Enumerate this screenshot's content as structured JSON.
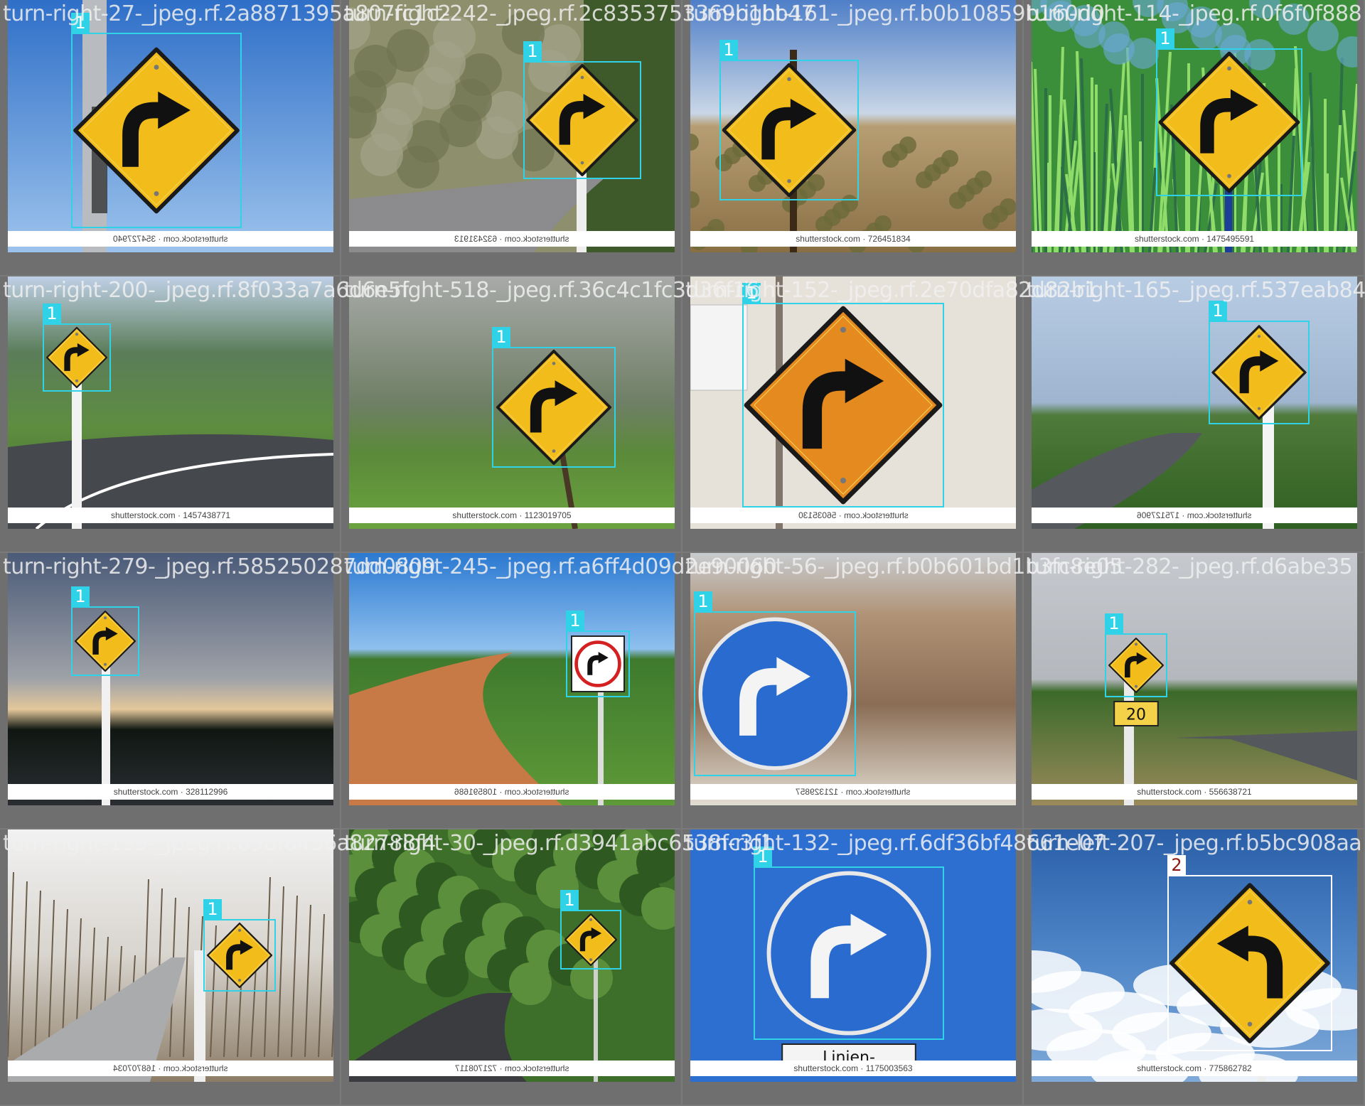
{
  "tiles": [
    {
      "filename": "turn-right-27-_jpeg.rf.2a8871395a807fc1c2",
      "watermark": "shutterstock.com · 354727940",
      "watermark_mirrored": true,
      "label": "1",
      "scene": "sky",
      "sign": "diamond-right"
    },
    {
      "filename": "turn-right-242-_jpeg.rf.2c8353753369b1bb47",
      "watermark": "shutterstock.com · 632431913",
      "watermark_mirrored": true,
      "label": "1",
      "scene": "forest-road",
      "sign": "diamond-right"
    },
    {
      "filename": "turn-right-161-_jpeg.rf.b0b10859b160d0",
      "watermark": "shutterstock.com · 726451834",
      "watermark_mirrored": false,
      "label": "1",
      "scene": "desert",
      "sign": "diamond-right"
    },
    {
      "filename": "turn-right-114-_jpeg.rf.0f6f0f888",
      "watermark": "shutterstock.com · 1475495591",
      "watermark_mirrored": false,
      "label": "1",
      "scene": "grass",
      "sign": "diamond-right"
    },
    {
      "filename": "turn-right-200-_jpeg.rf.8f033a7a6d6e5f",
      "watermark": "shutterstock.com · 1457438771",
      "watermark_mirrored": false,
      "label": "1",
      "scene": "hill-road",
      "sign": "diamond-right"
    },
    {
      "filename": "turn-right-518-_jpeg.rf.36c4c1fc3d36f16",
      "watermark": "shutterstock.com · 1123019705",
      "watermark_mirrored": false,
      "label": "1",
      "scene": "haze-field",
      "sign": "diamond-right"
    },
    {
      "filename": "turn-right-152-_jpeg.rf.2e70dfa82d82b1",
      "watermark": "shutterstock.com · 56035130",
      "watermark_mirrored": true,
      "label": "1",
      "scene": "pale",
      "sign": "diamond-orange"
    },
    {
      "filename": "turn-right-165-_jpeg.rf.537eab84",
      "watermark": "shutterstock.com · 175127906",
      "watermark_mirrored": true,
      "label": "1",
      "scene": "road-right",
      "sign": "diamond-right"
    },
    {
      "filename": "turn-right-279-_jpeg.rf.585250287dd0809",
      "watermark": "shutterstock.com · 328112996",
      "watermark_mirrored": false,
      "label": "1",
      "scene": "dusk",
      "sign": "diamond-right"
    },
    {
      "filename": "turn-right-245-_jpeg.rf.a6ff4d09d2e90060",
      "watermark": "shutterstock.com · 108591686",
      "watermark_mirrored": true,
      "label": "1",
      "scene": "dirt-road",
      "sign": "square-circle"
    },
    {
      "filename": "turn-right-56-_jpeg.rf.b0b601bd1b3fc8e05",
      "watermark": "shutterstock.com · 121329857",
      "watermark_mirrored": true,
      "label": "1",
      "scene": "rocks",
      "sign": "blue-circle"
    },
    {
      "filename": "turn-right-282-_jpeg.rf.d6abe35",
      "watermark": "shutterstock.com · 556638721",
      "watermark_mirrored": false,
      "label": "1",
      "scene": "road-left",
      "sign": "diamond-right-small",
      "plate": "20"
    },
    {
      "filename": "turn-right-199-_jpeg.rf.898f8456a82788f4",
      "watermark": "shutterstock.com · 168707034",
      "watermark_mirrored": true,
      "label": "1",
      "scene": "winter-road",
      "sign": "diamond-right"
    },
    {
      "filename": "turn-right-30-_jpeg.rf.d3941abc6538fc3f1",
      "watermark": "shutterstock.com · 721708117",
      "watermark_mirrored": true,
      "label": "1",
      "scene": "tree-road",
      "sign": "diamond-right"
    },
    {
      "filename": "turn-right-132-_jpeg.rf.6df36bf48661e07",
      "watermark": "shutterstock.com · 1175003563",
      "watermark_mirrored": false,
      "label": "1",
      "scene": "blue",
      "sign": "blue-circle",
      "plate": "Linien-"
    },
    {
      "filename": "turn-left-207-_jpeg.rf.b5bc908aa",
      "watermark": "shutterstock.com · 775862782",
      "watermark_mirrored": false,
      "label": "2",
      "label_style": "white",
      "scene": "clouds",
      "sign": "diamond-left"
    }
  ]
}
